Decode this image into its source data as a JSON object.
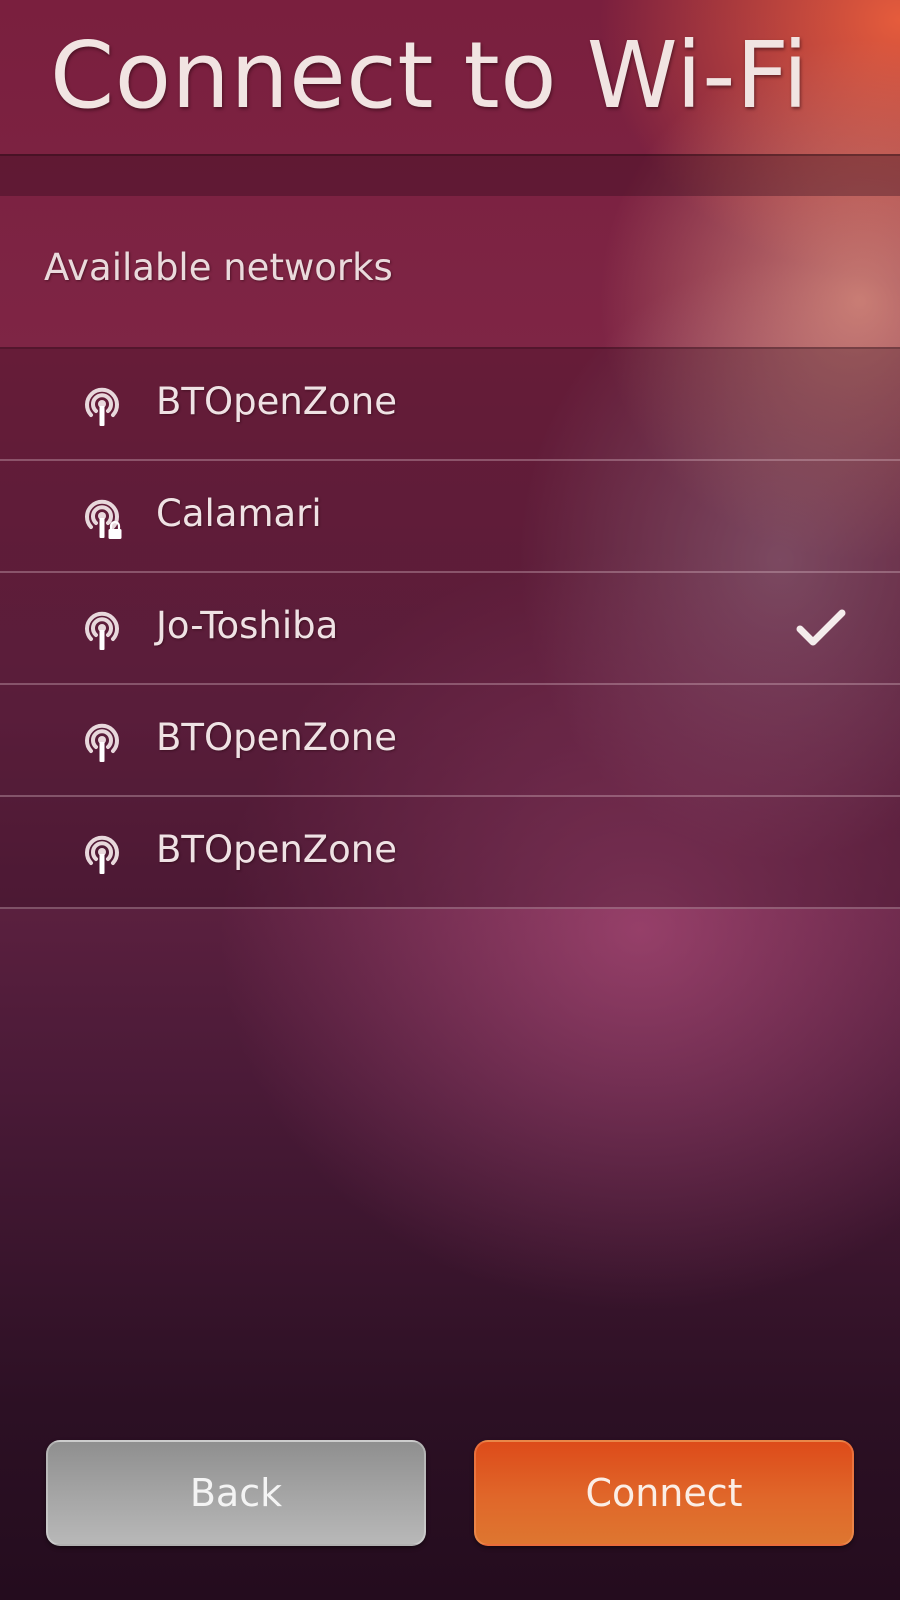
{
  "header": {
    "title": "Connect to Wi-Fi"
  },
  "section": {
    "label": "Available networks"
  },
  "networks": [
    {
      "name": "BTOpenZone",
      "secured": false,
      "connected": false,
      "icon": "wifi-signal-icon"
    },
    {
      "name": "Calamari",
      "secured": true,
      "connected": false,
      "icon": "wifi-signal-locked-icon"
    },
    {
      "name": "Jo-Toshiba",
      "secured": false,
      "connected": true,
      "icon": "wifi-signal-icon"
    },
    {
      "name": "BTOpenZone",
      "secured": false,
      "connected": false,
      "icon": "wifi-signal-icon"
    },
    {
      "name": "BTOpenZone",
      "secured": false,
      "connected": false,
      "icon": "wifi-signal-icon"
    }
  ],
  "buttons": {
    "back_label": "Back",
    "connect_label": "Connect"
  },
  "colors": {
    "connect_accent": "#dd4b1a",
    "back_gray": "#a6a6a6",
    "background_top": "#7a1f3e",
    "background_bottom": "#240c1e"
  }
}
